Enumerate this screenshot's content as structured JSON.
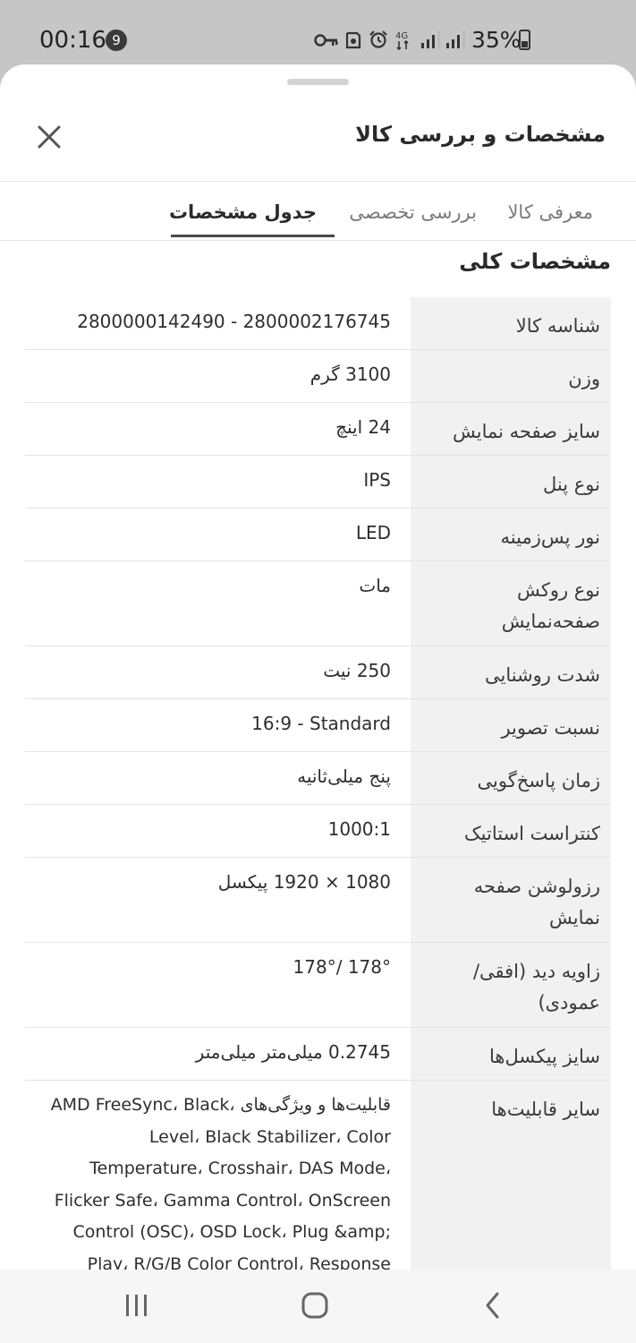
{
  "status_bar": {
    "time": "00:16",
    "notification_count": "9",
    "battery": "35%",
    "icons": [
      "key-icon",
      "android-icon",
      "alarm-icon",
      "data-4g-icon",
      "signal-icon",
      "signal-icon-2",
      "battery-icon"
    ]
  },
  "sheet": {
    "title": "مشخصات و بررسی کالا"
  },
  "tabs": [
    {
      "label": "معرفی کالا",
      "active": false
    },
    {
      "label": "بررسی تخصصی",
      "active": false
    },
    {
      "label": "جدول مشخصات",
      "active": true
    }
  ],
  "section": {
    "title": "مشخصات کلی"
  },
  "specs": [
    {
      "key": "شناسه کالا",
      "value": "2800000142490 - 2800002176745"
    },
    {
      "key": "وزن",
      "value": "3100 گرم"
    },
    {
      "key": "سایز صفحه نمایش",
      "value": "24 اینچ"
    },
    {
      "key": "نوع پنل",
      "value": "IPS"
    },
    {
      "key": "نور پس‌زمینه",
      "value": "LED"
    },
    {
      "key": "نوع روکش صفحه‌نمایش",
      "value": "مات"
    },
    {
      "key": "شدت روشنایی",
      "value": "250 نیت"
    },
    {
      "key": "نسبت تصویر",
      "value": "16:9 - Standard"
    },
    {
      "key": "زمان پاسخ‌گویی",
      "value": "پنج میلی‌ثانیه"
    },
    {
      "key": "کنتراست استاتیک",
      "value": "1000:1"
    },
    {
      "key": "رزولوشن صفحه نمایش",
      "value": "1080 × 1920 پیکسل"
    },
    {
      "key": "زاویه دید (افقی/عمودی)",
      "value": "178°/ 178°"
    },
    {
      "key": "سایز پیکسل‌ها",
      "value": "0.2745 میلی‌متر میلی‌متر"
    },
    {
      "key": "سایر قابلیت‌ها",
      "value": "قابلیت‌ها و ویژگی‌های ،AMD FreeSync، Black Level، Black Stabilizer، Color Temperature، Crosshair، DAS Mode، Flicker Safe، Gamma Control، OnScreen Control (OSC)، OSD Lock، Plug &amp; Play، R/G/B Color Control، Response"
    }
  ],
  "nav_bar": {
    "buttons": [
      "recents-button",
      "home-button",
      "back-button"
    ]
  }
}
